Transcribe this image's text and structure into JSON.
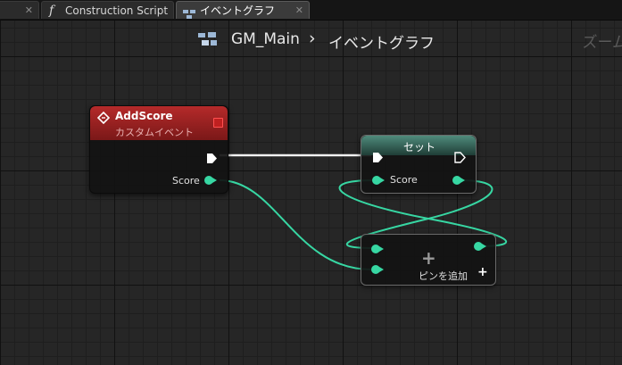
{
  "tabs": [
    {
      "label": ""
    },
    {
      "label": "Construction Script"
    },
    {
      "label": "イベントグラフ"
    }
  ],
  "breadcrumb": {
    "blueprint": "GM_Main",
    "separator": "›",
    "graph": "イベントグラフ"
  },
  "zoom_label": "ズーム",
  "nodes": {
    "event": {
      "title": "AddScore",
      "subtitle": "カスタムイベント",
      "pin_label": "Score"
    },
    "set": {
      "title": "セット",
      "pin_label": "Score"
    },
    "make": {
      "add_pin_label": "ピンを追加"
    }
  },
  "colors": {
    "event_header": "#8b1a1a",
    "set_header": "#2e5a50",
    "float_pin": "#37d7a3",
    "exec": "#ffffff"
  }
}
